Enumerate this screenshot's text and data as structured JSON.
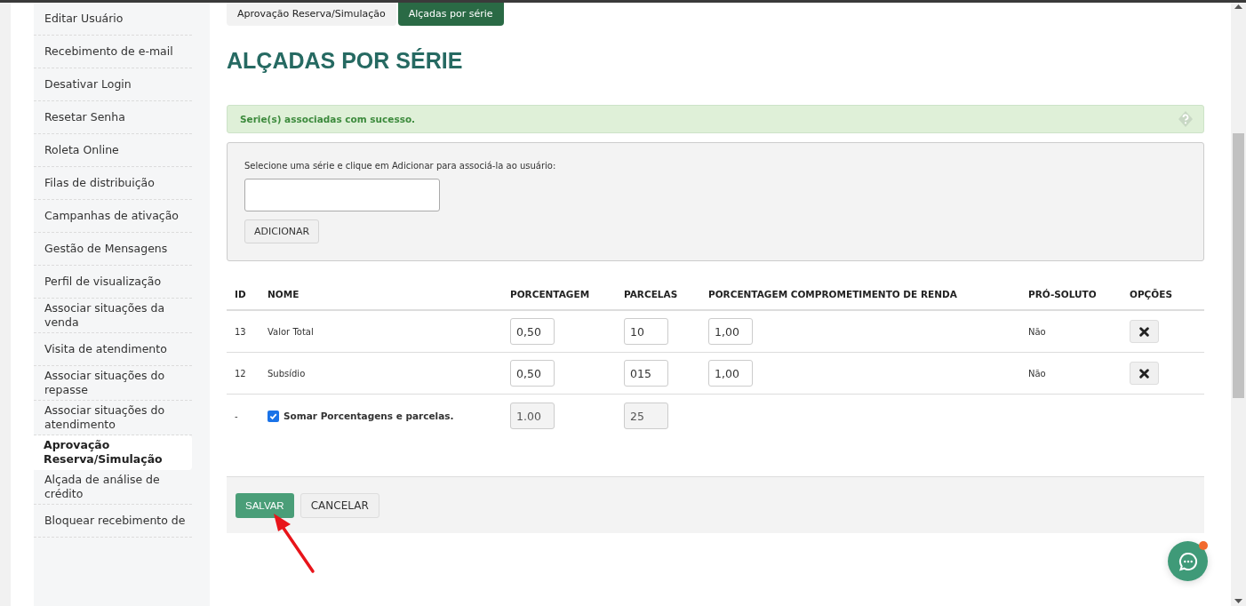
{
  "sidebar": {
    "items": [
      {
        "label": "Editar Usuário",
        "selected": false
      },
      {
        "label": "Recebimento de e-mail",
        "selected": false
      },
      {
        "label": "Desativar Login",
        "selected": false
      },
      {
        "label": "Resetar Senha",
        "selected": false
      },
      {
        "label": "Roleta Online",
        "selected": false
      },
      {
        "label": "Filas de distribuição",
        "selected": false
      },
      {
        "label": "Campanhas de ativação",
        "selected": false
      },
      {
        "label": "Gestão de Mensagens",
        "selected": false
      },
      {
        "label": "Perfil de visualização",
        "selected": false
      },
      {
        "label": "Associar situações da venda",
        "selected": false
      },
      {
        "label": "Visita de atendimento",
        "selected": false
      },
      {
        "label": "Associar situações do repasse",
        "selected": false
      },
      {
        "label": "Associar situações do atendimento",
        "selected": false
      },
      {
        "label": "Aprovação Reserva/Simulação",
        "selected": true
      },
      {
        "label": "Alçada de análise de crédito",
        "selected": false
      },
      {
        "label": "Bloquear recebimento de",
        "selected": false
      }
    ]
  },
  "tabs": [
    {
      "label": "Aprovação Reserva/Simulação",
      "selected": false
    },
    {
      "label": "Alçadas por série",
      "selected": true
    }
  ],
  "title": "ALÇADAS POR SÉRIE",
  "alert": {
    "text": "Serie(s) associadas com sucesso.",
    "kind": "success"
  },
  "form": {
    "instruction": "Selecione uma série e clique em Adicionar para associá-la ao usuário:",
    "add_button": "ADICIONAR"
  },
  "table": {
    "columns": [
      "ID",
      "NOME",
      "PORCENTAGEM",
      "PARCELAS",
      "PORCENTAGEM COMPROMETIMENTO DE RENDA",
      "PRÓ-SOLUTO",
      "OPÇÕES"
    ],
    "rows": [
      {
        "kind": "item",
        "id": "13",
        "name": "Valor Total",
        "porcentagem": "0,50",
        "parcelas": "10",
        "comprometimento": "1,00",
        "pro_soluto": "Não"
      },
      {
        "kind": "item",
        "id": "12",
        "name": "Subsídio",
        "porcentagem": "0,50",
        "parcelas": "015",
        "comprometimento": "1,00",
        "pro_soluto": "Não"
      },
      {
        "kind": "total",
        "id": "-",
        "label": "Somar Porcentagens e parcelas.",
        "checked": true,
        "porcentagem": "1.00",
        "parcelas": "25"
      }
    ]
  },
  "footer": {
    "buttons": [
      {
        "label": "SALVAR",
        "kind": "primary"
      },
      {
        "label": "CANCELAR",
        "kind": "default"
      }
    ]
  }
}
